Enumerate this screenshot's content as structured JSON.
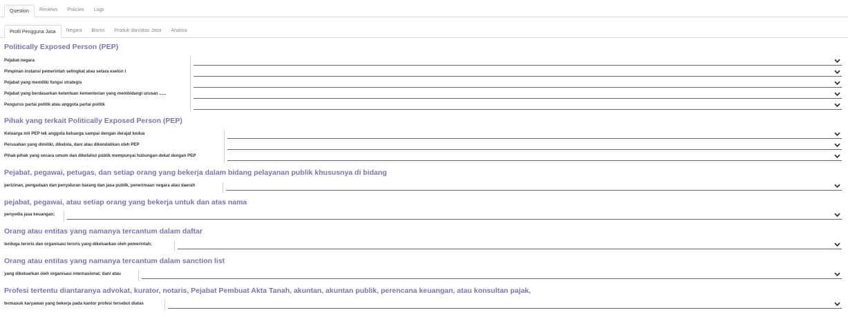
{
  "tabs_main": [
    {
      "label": "Question",
      "active": true
    },
    {
      "label": "Reviews",
      "active": false
    },
    {
      "label": "Policies",
      "active": false
    },
    {
      "label": "Logs",
      "active": false
    }
  ],
  "tabs_sub": [
    {
      "label": "Profil Pengguna Jasa",
      "active": true
    },
    {
      "label": "Negara",
      "active": false
    },
    {
      "label": "Bisnis",
      "active": false
    },
    {
      "label": "Produk dan/atau Jasa",
      "active": false
    },
    {
      "label": "Analisa",
      "active": false
    }
  ],
  "sections": [
    {
      "title": "Politically Exposed Person (PEP)",
      "fields": [
        {
          "label": "Pejabat negara",
          "value": ""
        },
        {
          "label": "Pimpinan instansi pemerintah setingkat atau setara eselon I",
          "value": ""
        },
        {
          "label": "Pejabat yang memiliki fungsi strategis",
          "value": ""
        },
        {
          "label": "Pejabat yang berdasarkan ketentuan kementerian yang membidangi urusan ......",
          "value": ""
        },
        {
          "label": "Pengurus partai politik atau anggota partai politik",
          "value": ""
        }
      ]
    },
    {
      "title": "Pihak yang terkait Politically Exposed Person (PEP)",
      "fields": [
        {
          "label": "Keluarga inti PEP tek anggota keluarga sampai dengan derajat kedua",
          "value": ""
        },
        {
          "label": "Perusahan yang dimiliki, dikelola, dan/ atau dikendalikan oleh PEP",
          "value": ""
        },
        {
          "label": "Pihak-pihak yang secara umum dan diketahui publik mempunyai hubungan dekat dengan PEP",
          "value": ""
        }
      ]
    },
    {
      "title": "Pejabat, pegawai, petugas, dan setiap orang yang bekerja dalam bidang pelayanan publik khususnya di bidang",
      "fields": [
        {
          "label": "perizinan, pengadaan dan penyaluran barang dan jasa publik, penerimaan negara atau daerah",
          "value": ""
        }
      ]
    },
    {
      "title": "pejabat, pegawai, atau setiap orang yang bekerja untuk dan atas nama",
      "fields": [
        {
          "label": "penyedia jasa keuangan;",
          "value": ""
        }
      ]
    },
    {
      "title": "Orang atau entitas yang namanya tercantum dalam daftar",
      "fields": [
        {
          "label": "terduga teroris dan organisasi teroris yang dikeluarkan oleh pemerintah;",
          "value": ""
        }
      ]
    },
    {
      "title": "Orang atau entitas yang namanya tercantum dalam sanction list",
      "fields": [
        {
          "label": "yang dikeluarkan oleh organisasi internasional; dan/ atau",
          "value": ""
        }
      ]
    },
    {
      "title": "Profesi tertentu diantaranya advokat, kurator, notaris, Pejabat Pembuat Akta Tanah, akuntan, akuntan publik, perencana keuangan, atau konsultan pajak,",
      "fields": [
        {
          "label": "termasuk karyawan yang bekerja pada kantor profesi tersebut diatas",
          "value": ""
        }
      ]
    }
  ],
  "icons": {
    "dropdown": "chevron-down-icon"
  },
  "colors": {
    "section_title": "#7b75ae",
    "text": "#333333",
    "tab_inactive": "#888888",
    "border": "#dcdcdc"
  }
}
